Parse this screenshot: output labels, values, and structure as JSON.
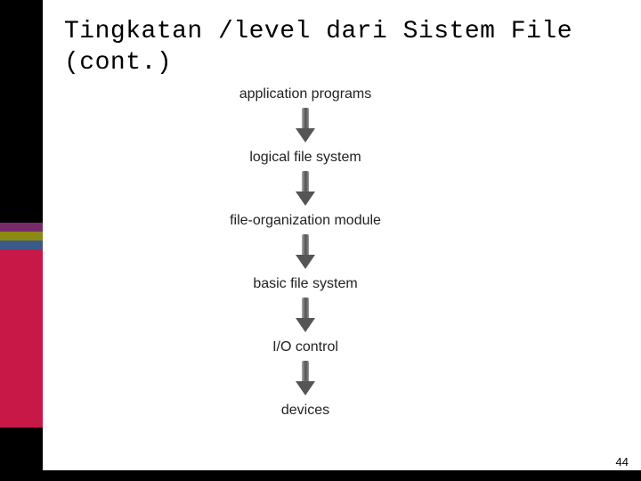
{
  "title": "Tingkatan /level dari Sistem File\n(cont.)",
  "levels": [
    "application programs",
    "logical file system",
    "file-organization module",
    "basic file system",
    "I/O control",
    "devices"
  ],
  "page_number": "44",
  "chart_data": {
    "type": "diagram",
    "title": "Tingkatan /level dari Sistem File (cont.)",
    "flow": "top-to-bottom",
    "nodes": [
      "application programs",
      "logical file system",
      "file-organization module",
      "basic file system",
      "I/O control",
      "devices"
    ],
    "edges": [
      [
        "application programs",
        "logical file system"
      ],
      [
        "logical file system",
        "file-organization module"
      ],
      [
        "file-organization module",
        "basic file system"
      ],
      [
        "basic file system",
        "I/O control"
      ],
      [
        "I/O control",
        "devices"
      ]
    ]
  }
}
